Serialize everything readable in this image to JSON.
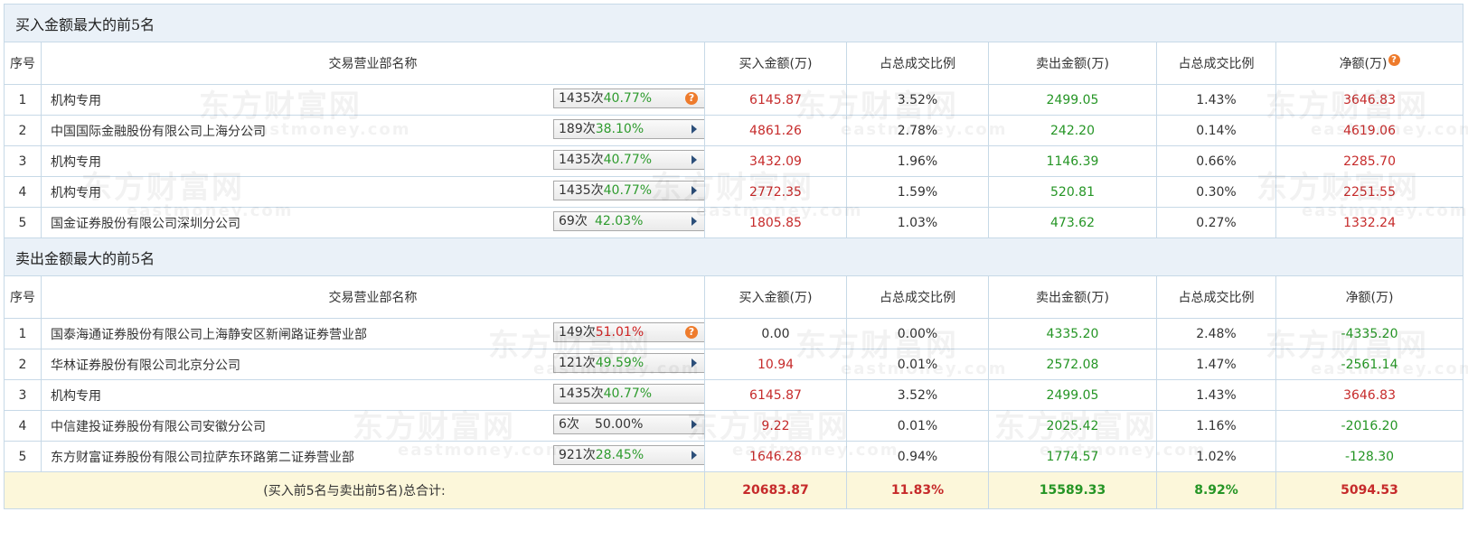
{
  "buy_section": {
    "title": "买入金额最大的前5名",
    "headers": {
      "rank": "序号",
      "name": "交易营业部名称",
      "buy": "买入金额(万)",
      "buy_pct": "占总成交比例",
      "sell": "卖出金额(万)",
      "sell_pct": "占总成交比例",
      "net": "净额(万)"
    },
    "rows": [
      {
        "rank": "1",
        "name": "机构专用",
        "count": "1435次",
        "rate": "40.77%",
        "rate_color": "up",
        "icon": "help-icon",
        "buy": "6145.87",
        "buy_pct": "3.52%",
        "sell": "2499.05",
        "sell_pct": "1.43%",
        "net": "3646.83",
        "net_color": "red"
      },
      {
        "rank": "2",
        "name": "中国国际金融股份有限公司上海分公司",
        "count": "189次",
        "rate": "38.10%",
        "rate_color": "up",
        "icon": "arrow-right-icon",
        "buy": "4861.26",
        "buy_pct": "2.78%",
        "sell": "242.20",
        "sell_pct": "0.14%",
        "net": "4619.06",
        "net_color": "red"
      },
      {
        "rank": "3",
        "name": "机构专用",
        "count": "1435次",
        "rate": "40.77%",
        "rate_color": "up",
        "icon": "arrow-right-icon",
        "buy": "3432.09",
        "buy_pct": "1.96%",
        "sell": "1146.39",
        "sell_pct": "0.66%",
        "net": "2285.70",
        "net_color": "red"
      },
      {
        "rank": "4",
        "name": "机构专用",
        "count": "1435次",
        "rate": "40.77%",
        "rate_color": "up",
        "icon": "arrow-right-icon",
        "buy": "2772.35",
        "buy_pct": "1.59%",
        "sell": "520.81",
        "sell_pct": "0.30%",
        "net": "2251.55",
        "net_color": "red"
      },
      {
        "rank": "5",
        "name": "国金证券股份有限公司深圳分公司",
        "count": "69次",
        "rate": "42.03%",
        "rate_color": "up",
        "icon": "arrow-right-icon",
        "buy": "1805.85",
        "buy_pct": "1.03%",
        "sell": "473.62",
        "sell_pct": "0.27%",
        "net": "1332.24",
        "net_color": "red"
      }
    ]
  },
  "sell_section": {
    "title": "卖出金额最大的前5名",
    "headers": {
      "rank": "序号",
      "name": "交易营业部名称",
      "buy": "买入金额(万)",
      "buy_pct": "占总成交比例",
      "sell": "卖出金额(万)",
      "sell_pct": "占总成交比例",
      "net": "净额(万)"
    },
    "rows": [
      {
        "rank": "1",
        "name": "国泰海通证券股份有限公司上海静安区新闸路证券营业部",
        "count": "149次",
        "rate": "51.01%",
        "rate_color": "down",
        "icon": "help-icon",
        "buy": "0.00",
        "buy_color": "dark",
        "buy_pct": "0.00%",
        "sell": "4335.20",
        "sell_pct": "2.48%",
        "net": "-4335.20",
        "net_color": "green"
      },
      {
        "rank": "2",
        "name": "华林证券股份有限公司北京分公司",
        "count": "121次",
        "rate": "49.59%",
        "rate_color": "up",
        "icon": "arrow-right-icon",
        "buy": "10.94",
        "buy_color": "red",
        "buy_pct": "0.01%",
        "sell": "2572.08",
        "sell_pct": "1.47%",
        "net": "-2561.14",
        "net_color": "green"
      },
      {
        "rank": "3",
        "name": "机构专用",
        "count": "1435次",
        "rate": "40.77%",
        "rate_color": "up",
        "icon": "none",
        "buy": "6145.87",
        "buy_color": "red",
        "buy_pct": "3.52%",
        "sell": "2499.05",
        "sell_pct": "1.43%",
        "net": "3646.83",
        "net_color": "red"
      },
      {
        "rank": "4",
        "name": "中信建投证券股份有限公司安徽分公司",
        "count": "6次",
        "rate": "50.00%",
        "rate_color": "dark",
        "icon": "arrow-right-icon",
        "buy": "9.22",
        "buy_color": "red",
        "buy_pct": "0.01%",
        "sell": "2025.42",
        "sell_pct": "1.16%",
        "net": "-2016.20",
        "net_color": "green"
      },
      {
        "rank": "5",
        "name": "东方财富证券股份有限公司拉萨东环路第二证券营业部",
        "count": "921次",
        "rate": "28.45%",
        "rate_color": "up",
        "icon": "arrow-right-icon",
        "buy": "1646.28",
        "buy_color": "red",
        "buy_pct": "0.94%",
        "sell": "1774.57",
        "sell_pct": "1.02%",
        "net": "-128.30",
        "net_color": "green"
      }
    ]
  },
  "total": {
    "label": "(买入前5名与卖出前5名)总合计:",
    "buy": "20683.87",
    "buy_pct": "11.83%",
    "sell": "15589.33",
    "sell_pct": "8.92%",
    "net": "5094.53"
  },
  "watermark": {
    "cn": "东方财富网",
    "en": "eastmoney.com"
  },
  "colors": {
    "positive": "#c62b2b",
    "negative": "#259525",
    "header_bg": "#eaf1f8",
    "total_bg": "#fcf7da",
    "border": "#c7d9e7",
    "help_icon": "#ee7b2c"
  }
}
